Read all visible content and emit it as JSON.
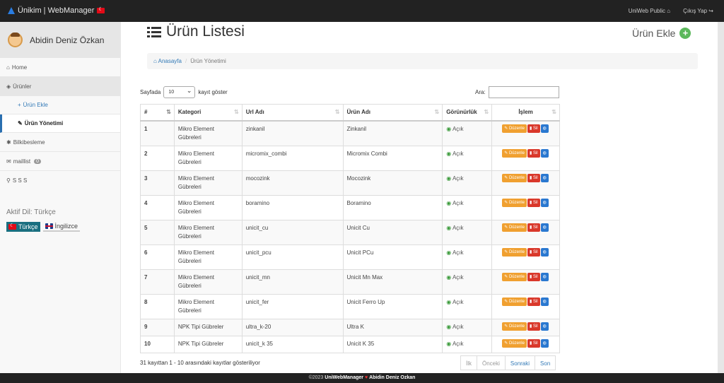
{
  "app": {
    "title": "Ünikim | WebManager"
  },
  "topnav": {
    "public_link": "UniWeb Public",
    "public_icon": "home-icon",
    "logout": "Çıkış Yap",
    "logout_icon": "sign-out-icon"
  },
  "user": {
    "name": "Abidin Deniz Özkan"
  },
  "sidebar": {
    "home": "Home",
    "products": "Ürünler",
    "add_product": "Ürün Ekle",
    "manage_products": "Ürün Yönetimi",
    "newsletter": "Bilkibesleme",
    "maillist": "maillist",
    "maillist_count": "0",
    "sss": "S S S"
  },
  "language": {
    "label": "Aktif Dil: Türkçe",
    "tr": "Türkçe",
    "en": "İngilizce"
  },
  "page": {
    "title": "Ürün Listesi",
    "add_button": "Ürün Ekle"
  },
  "breadcrumb": {
    "home": "Anasayfa",
    "current": "Ürün Yönetimi"
  },
  "table_controls": {
    "show_prefix": "Sayfada",
    "page_length": "10",
    "show_suffix": "kayıt göster",
    "search_label": "Ara:",
    "search_value": ""
  },
  "table": {
    "headers": [
      "#",
      "Kategori",
      "Url Adı",
      "Ürün Adı",
      "Görünürlük",
      "İşlem"
    ],
    "edit_label": "Düzenle",
    "delete_label": "Sil",
    "rows": [
      {
        "id": "1",
        "category": "Mikro Element Gübreleri",
        "url": "zinkanil",
        "name": "Zinkanil",
        "visibility": "Açık"
      },
      {
        "id": "2",
        "category": "Mikro Element Gübreleri",
        "url": "micromix_combi",
        "name": "Micromix Combi",
        "visibility": "Açık"
      },
      {
        "id": "3",
        "category": "Mikro Element Gübreleri",
        "url": "mocozink",
        "name": "Mocozink",
        "visibility": "Açık"
      },
      {
        "id": "4",
        "category": "Mikro Element Gübreleri",
        "url": "boramino",
        "name": "Boramino",
        "visibility": "Açık"
      },
      {
        "id": "5",
        "category": "Mikro Element Gübreleri",
        "url": "unicit_cu",
        "name": "Unicit Cu",
        "visibility": "Açık"
      },
      {
        "id": "6",
        "category": "Mikro Element Gübreleri",
        "url": "unicit_pcu",
        "name": "Unicit PCu",
        "visibility": "Açık"
      },
      {
        "id": "7",
        "category": "Mikro Element Gübreleri",
        "url": "unicit_mn",
        "name": "Unicit Mn Max",
        "visibility": "Açık"
      },
      {
        "id": "8",
        "category": "Mikro Element Gübreleri",
        "url": "unicit_fer",
        "name": "Unicit Ferro Up",
        "visibility": "Açık"
      },
      {
        "id": "9",
        "category": "NPK Tipi Gübreler",
        "url": "ultra_k-20",
        "name": "Ultra K",
        "visibility": "Açık"
      },
      {
        "id": "10",
        "category": "NPK Tipi Gübreler",
        "url": "unicit_k 35",
        "name": "Unicit K 35",
        "visibility": "Açık"
      }
    ]
  },
  "pagination": {
    "info": "31 kayıttan 1 - 10 arasındaki kayıtlar gösteriliyor",
    "first": "İlk",
    "prev": "Önceki",
    "next": "Sonraki",
    "last": "Son"
  },
  "footer": {
    "year": "©2023",
    "brand": "UniWebManager",
    "author": "Abidin Deniz Ozkan"
  },
  "colors": {
    "add_button": "#5cb85c",
    "edit": "#f0a030",
    "delete": "#d9382b",
    "view": "#2a78d0",
    "visible": "#3c9b3c"
  }
}
